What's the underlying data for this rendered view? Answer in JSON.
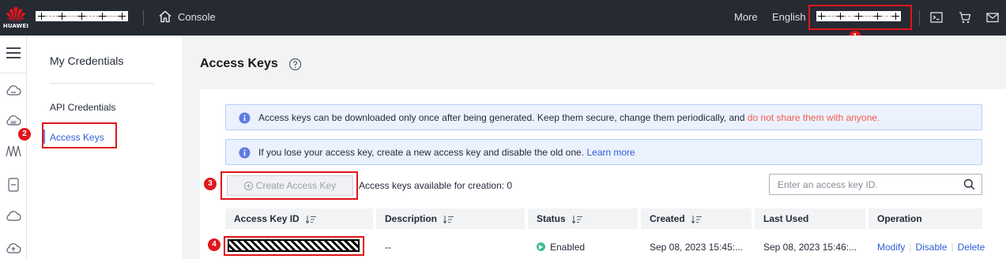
{
  "header": {
    "logo_text": "HUAWEI",
    "console_label": "Console",
    "more_label": "More",
    "language_label": "English"
  },
  "left_nav": {
    "title": "My Credentials",
    "items": [
      {
        "label": "API Credentials"
      },
      {
        "label": "Access Keys",
        "active": true
      }
    ]
  },
  "page": {
    "title": "Access Keys"
  },
  "alerts": [
    {
      "text": "Access keys can be downloaded only once after being generated. Keep them secure, change them periodically, and ",
      "warning": "do not share them with anyone."
    },
    {
      "text": "If you lose your access key, create a new access key and disable the old one. ",
      "link": "Learn more"
    }
  ],
  "toolbar": {
    "create_label": "Create Access Key",
    "available_text": "Access keys available for creation: 0",
    "search_placeholder": "Enter an access key ID."
  },
  "table": {
    "columns": [
      "Access Key ID",
      "Description",
      "Status",
      "Created",
      "Last Used",
      "Operation"
    ],
    "rows": [
      {
        "description": "--",
        "status": "Enabled",
        "created": "Sep 08, 2023 15:45:...",
        "last_used": "Sep 08, 2023 15:46:...",
        "operations": [
          "Modify",
          "Disable",
          "Delete"
        ]
      }
    ]
  },
  "annotations": [
    "1",
    "2",
    "3",
    "4"
  ],
  "colors": {
    "topbar": "#262a33",
    "accent": "#2f5ed6",
    "highlight": "#e0161b",
    "status_enabled": "#3fbf8f",
    "warning_text": "#f55a4e"
  }
}
